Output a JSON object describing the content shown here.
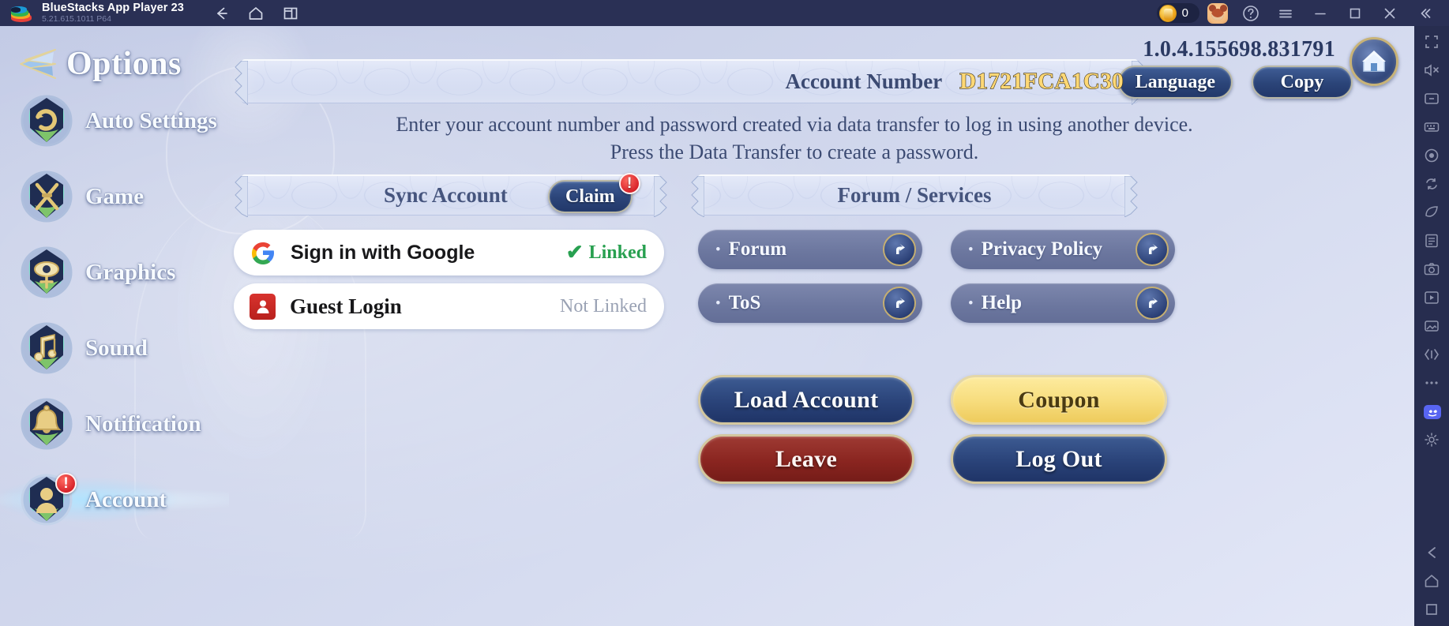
{
  "titlebar": {
    "app_name": "BlueStacks App Player 23",
    "app_version": "5.21.615.1011  P64",
    "logo_icon": "bluestacks-logo-icon",
    "nav": [
      {
        "name": "back-icon",
        "label": "Back"
      },
      {
        "name": "home-icon",
        "label": "Home"
      },
      {
        "name": "multi-instance-icon",
        "label": "Multi Instance"
      }
    ],
    "coin_icon": "coin-icon",
    "coin_count": "0",
    "avatar_icon": "bear-avatar-icon",
    "window_controls": [
      {
        "name": "help-icon",
        "label": "Help"
      },
      {
        "name": "hamburger-menu-icon",
        "label": "Menu"
      },
      {
        "name": "minimize-icon",
        "label": "Minimize"
      },
      {
        "name": "maximize-icon",
        "label": "Maximize"
      },
      {
        "name": "close-icon",
        "label": "Close"
      },
      {
        "name": "collapse-sidebar-icon",
        "label": "Collapse"
      }
    ]
  },
  "right_toolbar": [
    {
      "name": "fullscreen-icon"
    },
    {
      "name": "mute-icon"
    },
    {
      "name": "screen-rotate-icon"
    },
    {
      "name": "keymapping-icon"
    },
    {
      "name": "macro-record-icon"
    },
    {
      "name": "sync-operations-icon"
    },
    {
      "name": "eco-mode-icon"
    },
    {
      "name": "scripts-icon"
    },
    {
      "name": "screenshot-icon"
    },
    {
      "name": "media-manager-icon"
    },
    {
      "name": "gallery-icon"
    },
    {
      "name": "shake-icon"
    },
    {
      "name": "more-icon"
    },
    {
      "name": "discord-icon"
    },
    {
      "name": "settings-gear-icon"
    },
    {
      "name": "back-arrow-icon"
    },
    {
      "name": "android-home-icon"
    },
    {
      "name": "recent-apps-icon"
    }
  ],
  "sidebar": {
    "header_title": "Options",
    "header_icon": "options-gem-icon",
    "items": [
      {
        "label": "Auto Settings",
        "icon": "auto-settings-badge-icon",
        "active": false,
        "alert": false
      },
      {
        "label": "Game",
        "icon": "game-swords-badge-icon",
        "active": false,
        "alert": false
      },
      {
        "label": "Graphics",
        "icon": "graphics-eye-badge-icon",
        "active": false,
        "alert": false
      },
      {
        "label": "Sound",
        "icon": "sound-note-badge-icon",
        "active": false,
        "alert": false
      },
      {
        "label": "Notification",
        "icon": "notification-bell-badge-icon",
        "active": false,
        "alert": false
      },
      {
        "label": "Account",
        "icon": "account-person-badge-icon",
        "active": true,
        "alert": true,
        "alert_mark": "!"
      }
    ]
  },
  "content": {
    "version": "1.0.4.155698.831791",
    "home_icon": "home-circle-icon",
    "account_number_label": "Account Number",
    "account_number_value": "D1721FCA1C30",
    "language_button": "Language",
    "copy_button": "Copy",
    "info_line_1": "Enter your account number and password created via data transfer to log in using another device.",
    "info_line_2": "Press the Data Transfer to create a password.",
    "sync_section_title": "Sync Account",
    "claim_button": "Claim",
    "claim_alert_mark": "!",
    "forum_section_title": "Forum / Services",
    "accounts": [
      {
        "label": "Sign in with Google",
        "icon": "google-g-icon",
        "status": "Linked",
        "status_state": "linked",
        "check_glyph": "✔"
      },
      {
        "label": "Guest Login",
        "icon": "guest-avatar-icon",
        "status": "Not Linked",
        "status_state": "unlinked",
        "check_glyph": ""
      }
    ],
    "links": [
      {
        "label": "Forum",
        "bullet": "•",
        "go_icon": "external-link-arrow-icon"
      },
      {
        "label": "ToS",
        "bullet": "•",
        "go_icon": "external-link-arrow-icon"
      },
      {
        "label": "Privacy Policy",
        "bullet": "•",
        "go_icon": "external-link-arrow-icon"
      },
      {
        "label": "Help",
        "bullet": "•",
        "go_icon": "external-link-arrow-icon"
      }
    ],
    "actions": [
      {
        "label": "Load Account",
        "style": "blue"
      },
      {
        "label": "Leave",
        "style": "red"
      },
      {
        "label": "Coupon",
        "style": "gold"
      },
      {
        "label": "Log Out",
        "style": "blue"
      }
    ]
  },
  "colors": {
    "titlebar_bg": "#2a3055",
    "right_toolbar_bg": "#272d4f",
    "game_bg": "#ccd3ea",
    "accent_gold": "#ffd875",
    "button_blue": "#2b4478",
    "button_red": "#8a2520",
    "button_gold": "#f7dd7e",
    "linked_green": "#28a050",
    "unlinked_gray": "#9aa2b4",
    "alert_red": "#d8242a",
    "text_dark_blue": "#3b4a72"
  }
}
